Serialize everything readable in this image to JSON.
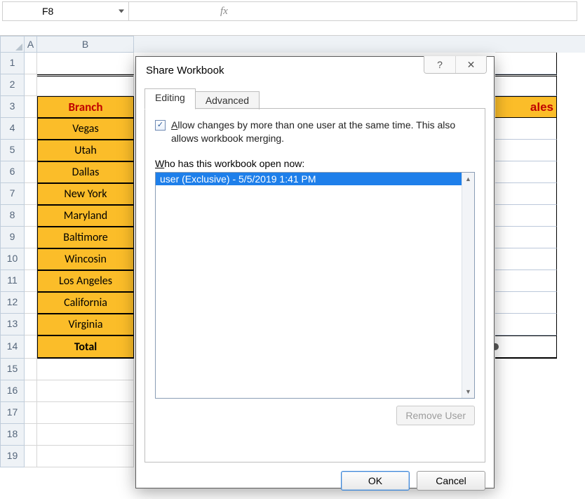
{
  "formula_bar": {
    "cell_ref": "F8",
    "fx_label": "fx"
  },
  "columns": {
    "a": "A",
    "b": "B"
  },
  "rows": [
    "1",
    "2",
    "3",
    "4",
    "5",
    "6",
    "7",
    "8",
    "9",
    "10",
    "11",
    "12",
    "13",
    "14",
    "15",
    "16",
    "17",
    "18",
    "19"
  ],
  "branch_header": "Branch",
  "branches": [
    "Vegas",
    "Utah",
    "Dallas",
    "New York",
    "Maryland",
    "Baltimore",
    "Wincosin",
    "Los Angeles",
    "California",
    "Virginia"
  ],
  "total_label": "Total",
  "right_header_fragment": "ales",
  "dialog": {
    "title": "Share Workbook",
    "tabs": {
      "editing": "Editing",
      "advanced": "Advanced"
    },
    "allow_label_a": "A",
    "allow_label_rest": "llow changes by more than one user at the same time.  This also allows workbook merging.",
    "who_w": "W",
    "who_rest": "ho has this workbook open now:",
    "users": [
      "user (Exclusive) - 5/5/2019 1:41 PM"
    ],
    "remove_user": "Remove User",
    "ok": "OK",
    "cancel": "Cancel"
  }
}
